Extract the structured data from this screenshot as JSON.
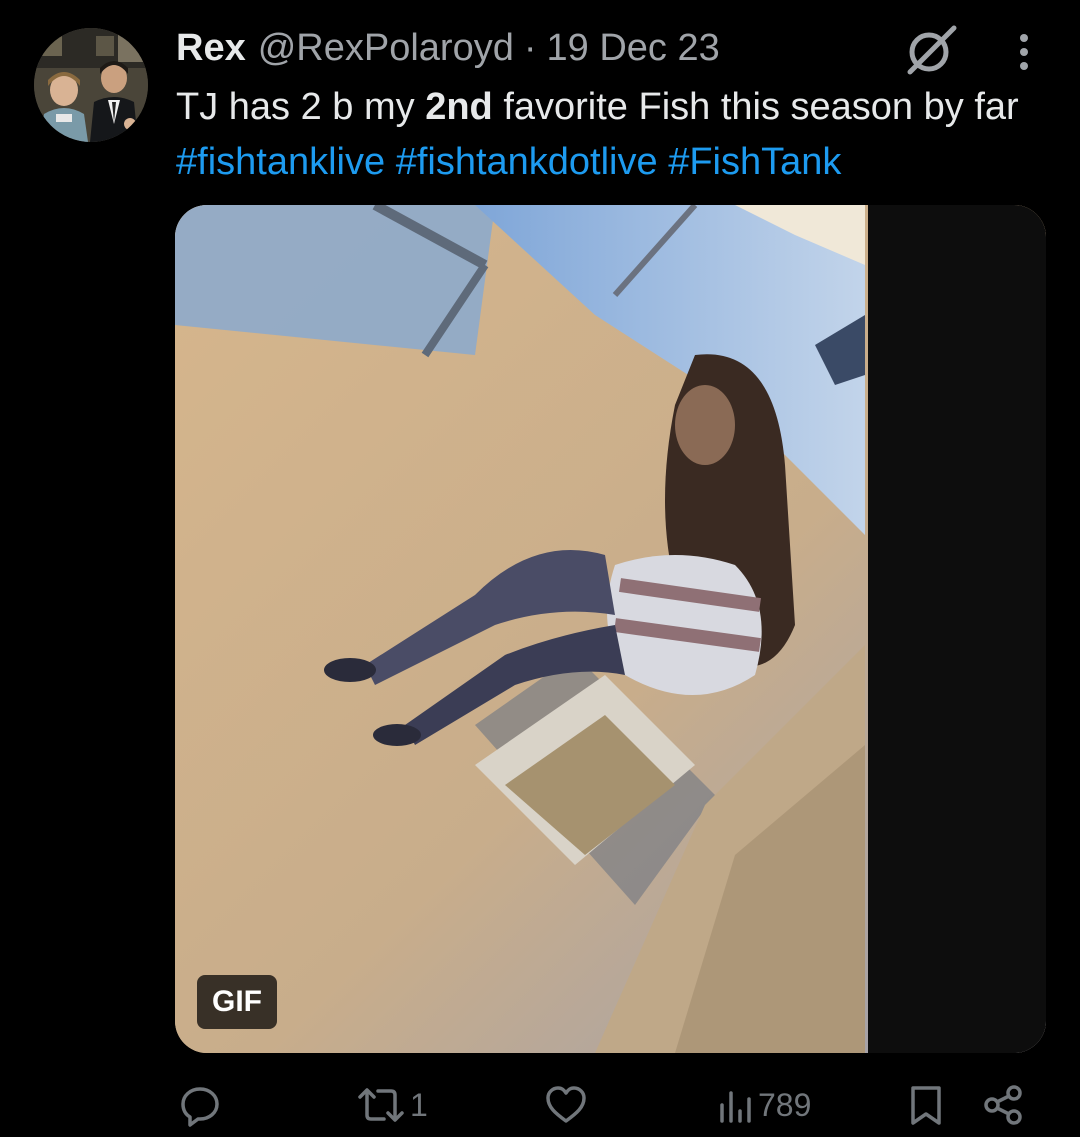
{
  "tweet": {
    "display_name": "Rex",
    "handle": "@RexPolaroyd",
    "separator": "·",
    "date": "19 Dec 23",
    "text": {
      "part1": "TJ has 2 b my ",
      "bold": "2nd",
      "part2": " favorite Fish this season by far ",
      "hashtags": [
        "#fishtanklive",
        "#fishtankdotlive",
        "#FishTank"
      ]
    },
    "media": {
      "badge": "GIF"
    }
  },
  "actions": {
    "reply_icon": "reply-icon",
    "retweet_icon": "retweet-icon",
    "retweet_count": "1",
    "like_icon": "heart-icon",
    "views_icon": "views-chart-icon",
    "views_count": "789",
    "bookmark_icon": "bookmark-icon",
    "share_icon": "share-icon"
  },
  "colors": {
    "background": "#000000",
    "text_primary": "#e7e9ea",
    "text_secondary": "#71767b",
    "link": "#1d9bf0"
  }
}
